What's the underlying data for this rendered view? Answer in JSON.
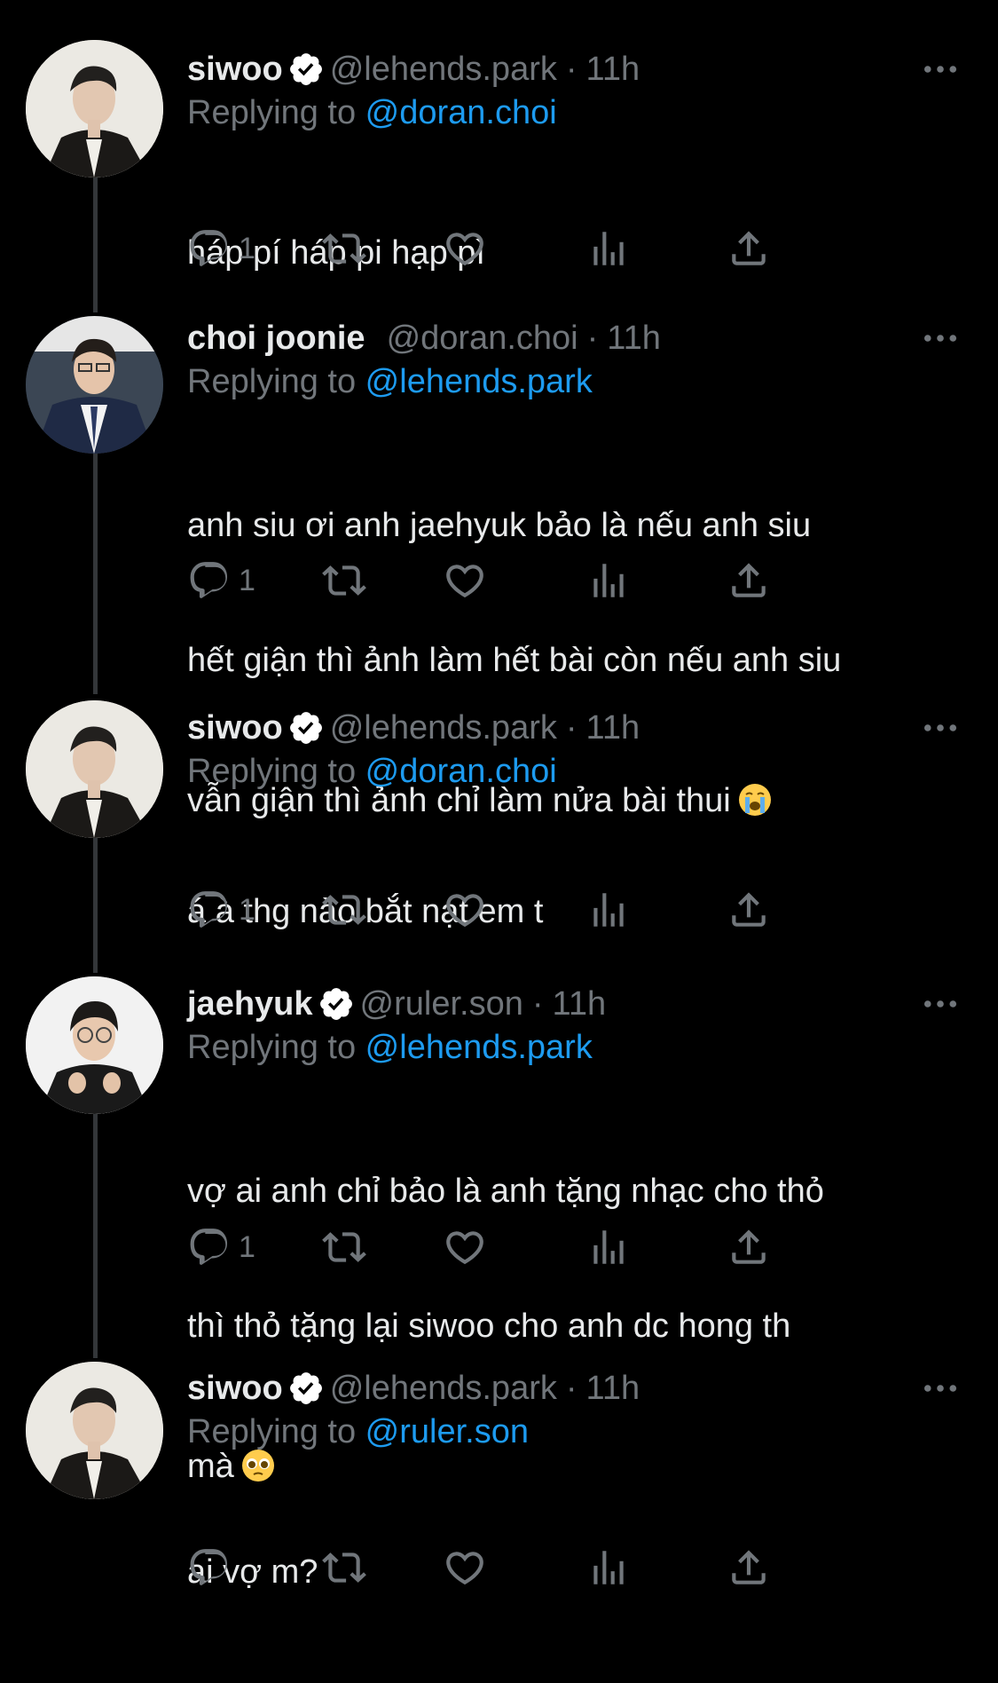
{
  "tweets": [
    {
      "name": "siwoo",
      "verified": true,
      "handle": "@lehends.park",
      "time": "11h",
      "replying_prefix": "Replying to ",
      "replying_to": "@doran.choi",
      "lines": [
        "háp pí háp pi hạp pì"
      ],
      "emoji": "",
      "reply_count": "1",
      "avatar": "siwoo-avatar"
    },
    {
      "name": "choi joonie",
      "verified": false,
      "handle": "@doran.choi",
      "time": "11h",
      "replying_prefix": "Replying to ",
      "replying_to": "@lehends.park",
      "lines": [
        "anh siu ơi anh jaehyuk bảo là nếu anh siu",
        "hết giận thì ảnh làm hết bài còn nếu anh siu",
        "vẫn giận thì ảnh chỉ làm nửa bài thui"
      ],
      "emoji": "loudly-crying-face",
      "reply_count": "1",
      "avatar": "joonie-avatar"
    },
    {
      "name": "siwoo",
      "verified": true,
      "handle": "@lehends.park",
      "time": "11h",
      "replying_prefix": "Replying to ",
      "replying_to": "@doran.choi",
      "lines": [
        "á à thg nào bắt nạt em t"
      ],
      "emoji": "",
      "reply_count": "1",
      "avatar": "siwoo-avatar"
    },
    {
      "name": "jaehyuk",
      "verified": true,
      "handle": "@ruler.son",
      "time": "11h",
      "replying_prefix": "Replying to ",
      "replying_to": "@lehends.park",
      "lines": [
        "vợ ai anh chỉ bảo là anh tặng nhạc cho thỏ",
        "thì thỏ tặng lại siwoo cho anh dc hong th",
        "mà"
      ],
      "emoji": "pleading-face",
      "reply_count": "1",
      "avatar": "jaehyuk-avatar"
    },
    {
      "name": "siwoo",
      "verified": true,
      "handle": "@lehends.park",
      "time": "11h",
      "replying_prefix": "Replying to ",
      "replying_to": "@ruler.son",
      "lines": [
        "ai vợ m?"
      ],
      "emoji": "",
      "reply_count": "",
      "avatar": "siwoo-avatar"
    }
  ],
  "dot_separator": "·",
  "icons": {
    "verified": "verified-badge-icon",
    "more": "more-icon",
    "reply": "reply-icon",
    "retweet": "retweet-icon",
    "like": "like-icon",
    "views": "views-icon",
    "share": "share-icon"
  },
  "colors": {
    "background": "#000000",
    "text": "#e7e9ea",
    "secondary": "#71767b",
    "mention": "#1d9bf0",
    "thread_line": "#333639"
  }
}
